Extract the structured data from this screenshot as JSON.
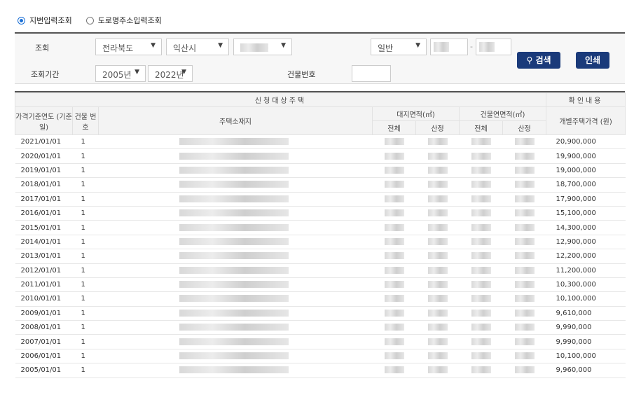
{
  "search_mode": {
    "options": [
      {
        "label": "지번입력조회",
        "selected": true
      },
      {
        "label": "도로명주소입력조회",
        "selected": false
      }
    ]
  },
  "filters": {
    "region_label": "조회",
    "province": "전라북도",
    "city": "익산시",
    "land_type": "일반",
    "period_label": "조회기간",
    "year_from": "2005년",
    "year_to": "2022년",
    "building_no_label": "건물번호",
    "search_button": "검색",
    "print_button": "인쇄"
  },
  "table": {
    "group_header_left": "신청대상주택",
    "group_header_right": "확인내용",
    "col_date": "가격기준연도 (기준일)",
    "col_bldg": "건물 번호",
    "col_addr": "주택소재지",
    "col_land": "대지면적(㎡)",
    "col_floor": "건물연면적(㎡)",
    "col_total": "전체",
    "col_calc": "산정",
    "col_price": "개별주택가격 (원)",
    "rows": [
      {
        "date": "2021/01/01",
        "bldg": "1",
        "price": "20,900,000"
      },
      {
        "date": "2020/01/01",
        "bldg": "1",
        "price": "19,900,000"
      },
      {
        "date": "2019/01/01",
        "bldg": "1",
        "price": "19,000,000"
      },
      {
        "date": "2018/01/01",
        "bldg": "1",
        "price": "18,700,000"
      },
      {
        "date": "2017/01/01",
        "bldg": "1",
        "price": "17,900,000"
      },
      {
        "date": "2016/01/01",
        "bldg": "1",
        "price": "15,100,000"
      },
      {
        "date": "2015/01/01",
        "bldg": "1",
        "price": "14,300,000"
      },
      {
        "date": "2014/01/01",
        "bldg": "1",
        "price": "12,900,000"
      },
      {
        "date": "2013/01/01",
        "bldg": "1",
        "price": "12,200,000"
      },
      {
        "date": "2012/01/01",
        "bldg": "1",
        "price": "11,200,000"
      },
      {
        "date": "2011/01/01",
        "bldg": "1",
        "price": "10,300,000"
      },
      {
        "date": "2010/01/01",
        "bldg": "1",
        "price": "10,100,000"
      },
      {
        "date": "2009/01/01",
        "bldg": "1",
        "price": "9,610,000"
      },
      {
        "date": "2008/01/01",
        "bldg": "1",
        "price": "9,990,000"
      },
      {
        "date": "2007/01/01",
        "bldg": "1",
        "price": "9,990,000"
      },
      {
        "date": "2006/01/01",
        "bldg": "1",
        "price": "10,100,000"
      },
      {
        "date": "2005/01/01",
        "bldg": "1",
        "price": "9,960,000"
      }
    ]
  }
}
